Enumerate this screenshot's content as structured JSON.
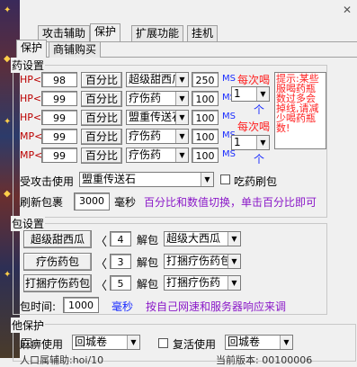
{
  "tabs": [
    {
      "label": "攻击辅助"
    },
    {
      "label": "保护"
    },
    {
      "label": "扩展功能"
    },
    {
      "label": "挂机"
    }
  ],
  "subtabs": [
    {
      "label": "保护"
    },
    {
      "label": "商铺购买"
    }
  ],
  "drug_group": {
    "title": "药设置",
    "rows": [
      {
        "stat": "HP<",
        "value": "98",
        "pct": "百分比",
        "item": "超级甜西瓜",
        "qty": "250",
        "unit": "MS"
      },
      {
        "stat": "HP<",
        "value": "99",
        "pct": "百分比",
        "item": "疗伤药",
        "qty": "100",
        "unit": "MS"
      },
      {
        "stat": "HP<",
        "value": "99",
        "pct": "百分比",
        "item": "盟重传送石",
        "qty": "100",
        "unit": "MS"
      },
      {
        "stat": "MP<",
        "value": "99",
        "pct": "百分比",
        "item": "疗伤药",
        "qty": "100",
        "unit": "MS"
      },
      {
        "stat": "MP<",
        "value": "99",
        "pct": "百分比",
        "item": "疗伤药",
        "qty": "100",
        "unit": "MS"
      }
    ],
    "per_drink_1": {
      "label": "每次喝",
      "value": "1",
      "suffix": "个"
    },
    "per_drink_2": {
      "label": "每次喝",
      "value": "1",
      "suffix": "个"
    },
    "hint": "提示:某些服喝药瓶数过多会掉线,请减少喝药瓶数!",
    "attacked_label": "受攻击使用",
    "attacked_item": "盟重传送石",
    "eat_brush_label": "吃药刷包",
    "refresh_label": "刷新包裹",
    "refresh_value": "3000",
    "refresh_unit": "毫秒",
    "refresh_tip": "百分比和数值切换，单击百分比即可"
  },
  "pack_group": {
    "title": "包设置",
    "rows": [
      {
        "source": "超级甜西瓜",
        "qty": "4",
        "label": "解包",
        "target": "超级大西瓜"
      },
      {
        "source": "疗伤药包",
        "qty": "3",
        "label": "解包",
        "target": "打捆疗伤药包"
      },
      {
        "source": "打捆疗伤药包",
        "qty": "5",
        "label": "解包",
        "target": "打捆疗伤药"
      }
    ],
    "time_label": "包时间:",
    "time_value": "1000",
    "time_unit": "毫秒",
    "time_tip": "按自己网速和服务器响应来调"
  },
  "protect_group": {
    "title": "他保护",
    "paralysis_label": "麻痹使用",
    "paralysis_item": "回城卷",
    "revive_label": "复活使用",
    "revive_item": "回城卷",
    "bottom_left": "人口属辅助:hoi/10",
    "bottom_right": "当前版本: 00100006"
  },
  "colors": {
    "blue": "#1a2cff",
    "purple": "#8a18c8",
    "red": "#ff2020"
  }
}
